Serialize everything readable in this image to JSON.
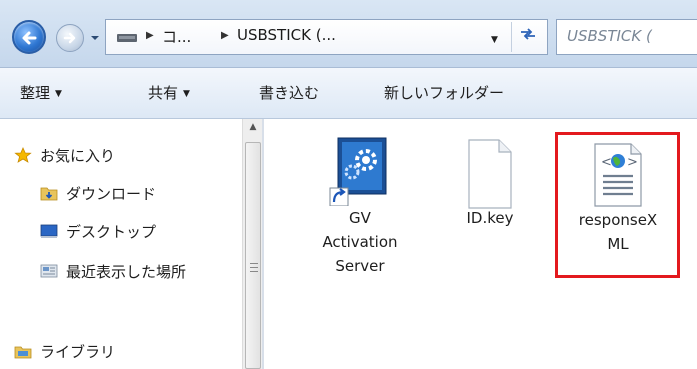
{
  "address_bar": {
    "breadcrumbs": [
      "コ...",
      "USBSTICK (..."
    ],
    "search_placeholder": "USBSTICK (",
    "icons": {
      "back": "back-arrow-icon",
      "forward": "forward-arrow-icon",
      "refresh": "refresh-icon",
      "drive": "drive-icon"
    }
  },
  "command_bar": {
    "organize": "整理",
    "share": "共有",
    "burn": "書き込む",
    "new_folder": "新しいフォルダー"
  },
  "nav_pane": {
    "items": [
      {
        "label": "お気に入り",
        "icon": "star-icon"
      },
      {
        "label": "ダウンロード",
        "icon": "downloads-folder-icon"
      },
      {
        "label": "デスクトップ",
        "icon": "desktop-icon"
      },
      {
        "label": "最近表示した場所",
        "icon": "recent-places-icon"
      },
      {
        "label": "ライブラリ",
        "icon": "libraries-icon"
      }
    ]
  },
  "files": [
    {
      "name_lines": [
        "GV",
        "Activation",
        "Server"
      ],
      "icon": "shortcut-app-icon"
    },
    {
      "name_lines": [
        "ID.key"
      ],
      "icon": "blank-file-icon"
    },
    {
      "name_lines": [
        "responseX",
        "ML"
      ],
      "icon": "xml-file-icon",
      "highlighted": true
    }
  ],
  "colors": {
    "highlight": "#e3191e",
    "accent": "#2f77d2"
  }
}
